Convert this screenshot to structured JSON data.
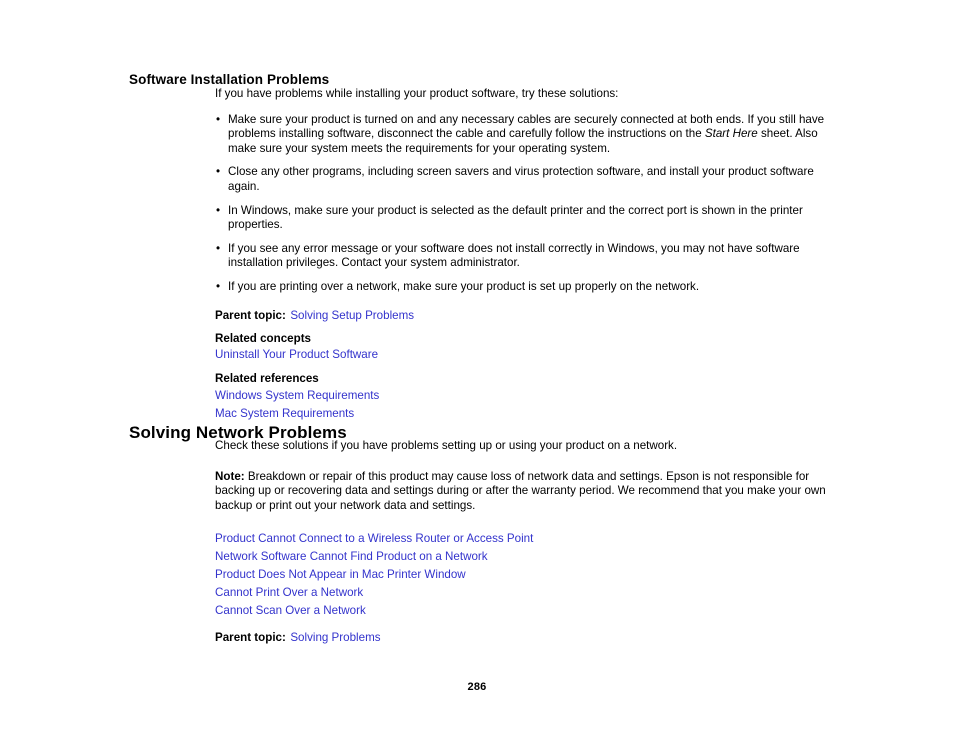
{
  "page": {
    "number": "286"
  },
  "section_software": {
    "heading": "Software Installation Problems",
    "intro": "If you have problems while installing your product software, try these solutions:",
    "bullet_marker": "•",
    "bullets": [
      {
        "part1": "Make sure your product is turned on and any necessary cables are securely connected at both ends. If you still have problems installing software, disconnect the cable and carefully follow the instructions on the ",
        "italic": "Start Here",
        "part2": " sheet. Also make sure your system meets the requirements for your operating system."
      },
      {
        "part1": "Close any other programs, including screen savers and virus protection software, and install your product software again.",
        "italic": "",
        "part2": ""
      },
      {
        "part1": "In Windows, make sure your product is selected as the default printer and the correct port is shown in the printer properties.",
        "italic": "",
        "part2": ""
      },
      {
        "part1": "If you see any error message or your software does not install correctly in Windows, you may not have software installation privileges. Contact your system administrator.",
        "italic": "",
        "part2": ""
      },
      {
        "part1": "If you are printing over a network, make sure your product is set up properly on the network.",
        "italic": "",
        "part2": ""
      }
    ],
    "parent_topic_label": "Parent topic:",
    "parent_topic_link": "Solving Setup Problems",
    "related_concepts_label": "Related concepts",
    "related_concepts_links": [
      "Uninstall Your Product Software"
    ],
    "related_references_label": "Related references",
    "related_references_links": [
      "Windows System Requirements",
      "Mac System Requirements"
    ]
  },
  "section_network": {
    "heading": "Solving Network Problems",
    "intro": "Check these solutions if you have problems setting up or using your product on a network.",
    "note_label": "Note:",
    "note_text": " Breakdown or repair of this product may cause loss of network data and settings. Epson is not responsible for backing up or recovering data and settings during or after the warranty period. We recommend that you make your own backup or print out your network data and settings.",
    "topic_links": [
      "Product Cannot Connect to a Wireless Router or Access Point",
      "Network Software Cannot Find Product on a Network",
      "Product Does Not Appear in Mac Printer Window",
      "Cannot Print Over a Network",
      "Cannot Scan Over a Network"
    ],
    "parent_topic_label": "Parent topic:",
    "parent_topic_link": "Solving Problems"
  },
  "colors": {
    "link": "#3333cc",
    "text": "#000000",
    "background": "#ffffff"
  }
}
